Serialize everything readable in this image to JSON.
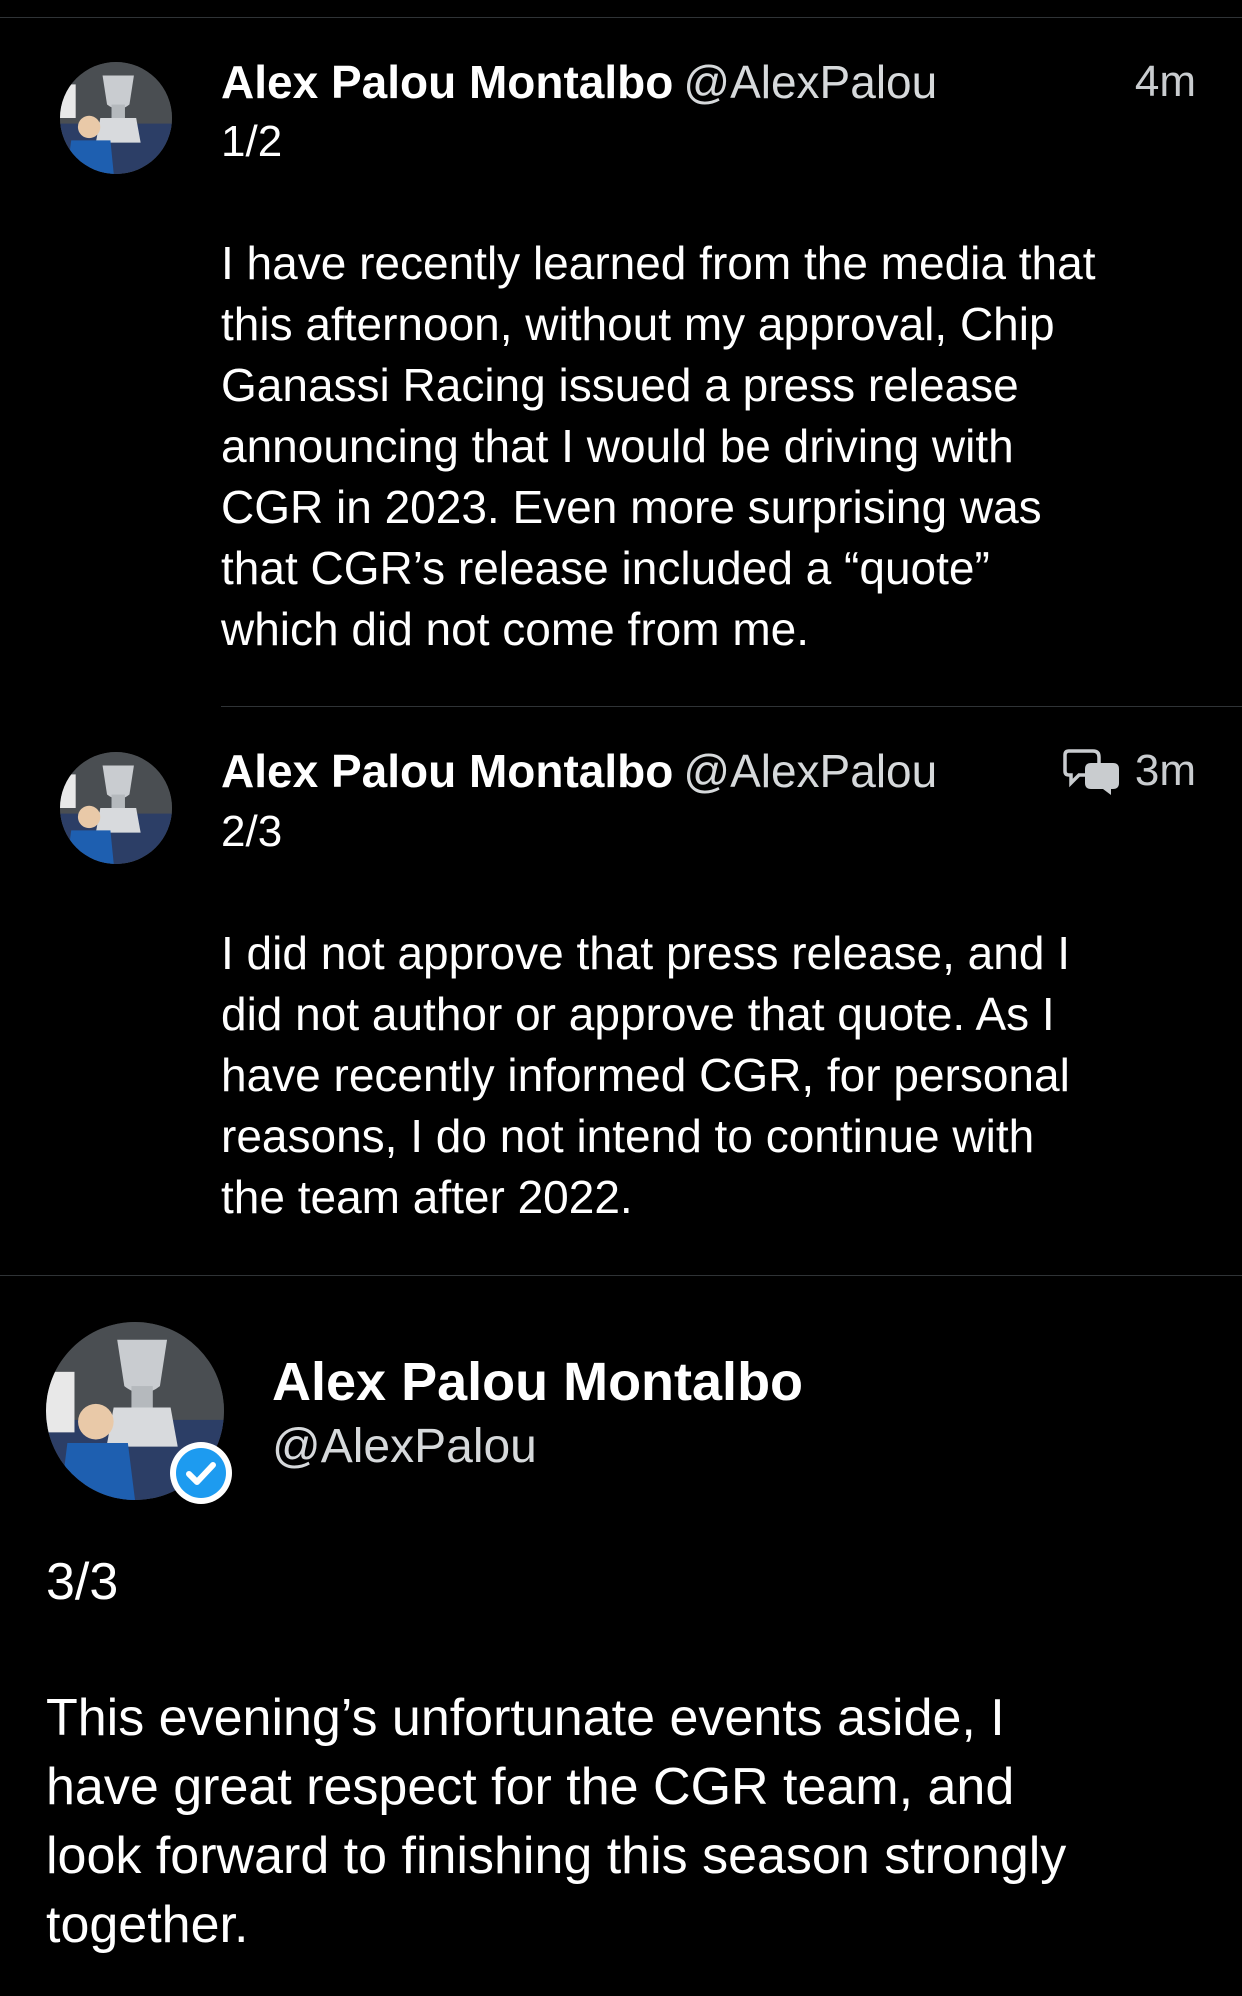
{
  "thread": [
    {
      "author_name": "Alex Palou Montalbo",
      "author_handle": "@AlexPalou",
      "timestamp": "4m",
      "counter": "1/2",
      "body": "I have recently learned from the media that\nthis afternoon, without my approval, Chip\nGanassi Racing issued a press release\nannouncing that I would be driving with\nCGR in 2023.  Even more surprising was\nthat CGR’s release included a  “quote”\n which did not come from me."
    },
    {
      "author_name": "Alex Palou Montalbo",
      "author_handle": "@AlexPalou",
      "timestamp": "3m",
      "counter": "2/3",
      "body": "I did not approve that press release, and I\ndid not author or approve that quote.  As I\nhave recently informed CGR, for personal\nreasons, I do not intend to continue with\nthe team after 2022.",
      "thread_icon": "conversation-icon"
    }
  ],
  "main_tweet": {
    "author_name": "Alex Palou Montalbo",
    "author_handle": "@AlexPalou",
    "verified_icon": "verified-badge-icon",
    "counter": "3/3",
    "body": "This evening’s unfortunate events aside, I\nhave great respect for the CGR team, and\nlook forward to finishing this season strongly\ntogether."
  },
  "colors": {
    "background": "#000000",
    "text": "#ffffff",
    "secondary_text": "#d6d9db",
    "divider": "#2f3336",
    "verified_blue": "#1d9bf0"
  }
}
